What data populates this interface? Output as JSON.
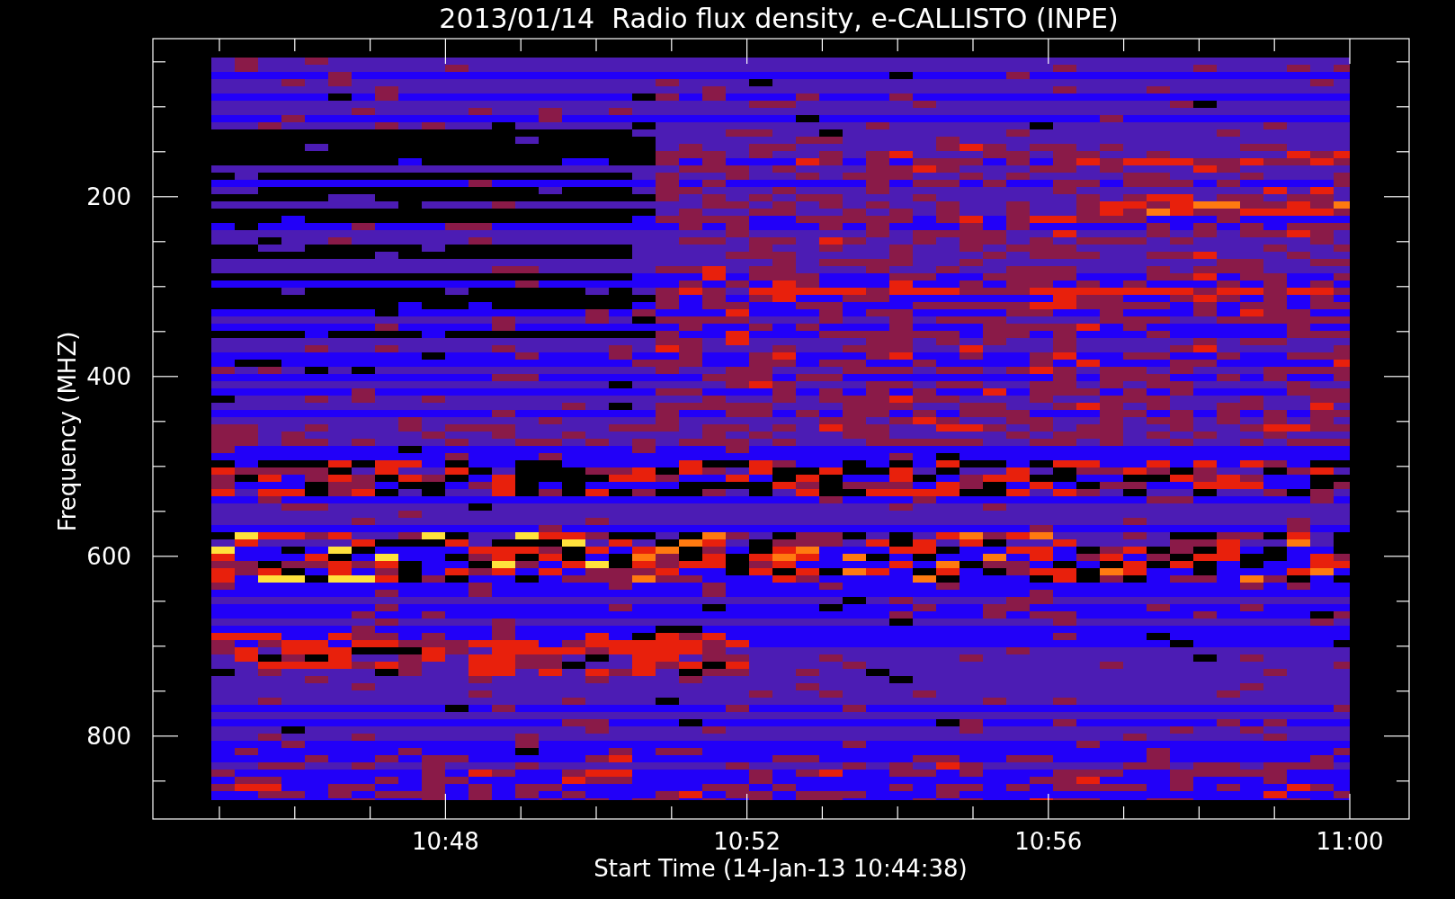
{
  "title": "2013/01/14  Radio flux density, e-CALLISTO (INPE)",
  "chart": {
    "ylabel": "Frequency (MHZ)",
    "yticks": [
      "200",
      "400",
      "600",
      "800"
    ],
    "xticks": [
      "10:48",
      "10:52",
      "10:56",
      "11:00"
    ],
    "xlabel": "Start Time (14-Jan-13 10:44:38)"
  }
}
